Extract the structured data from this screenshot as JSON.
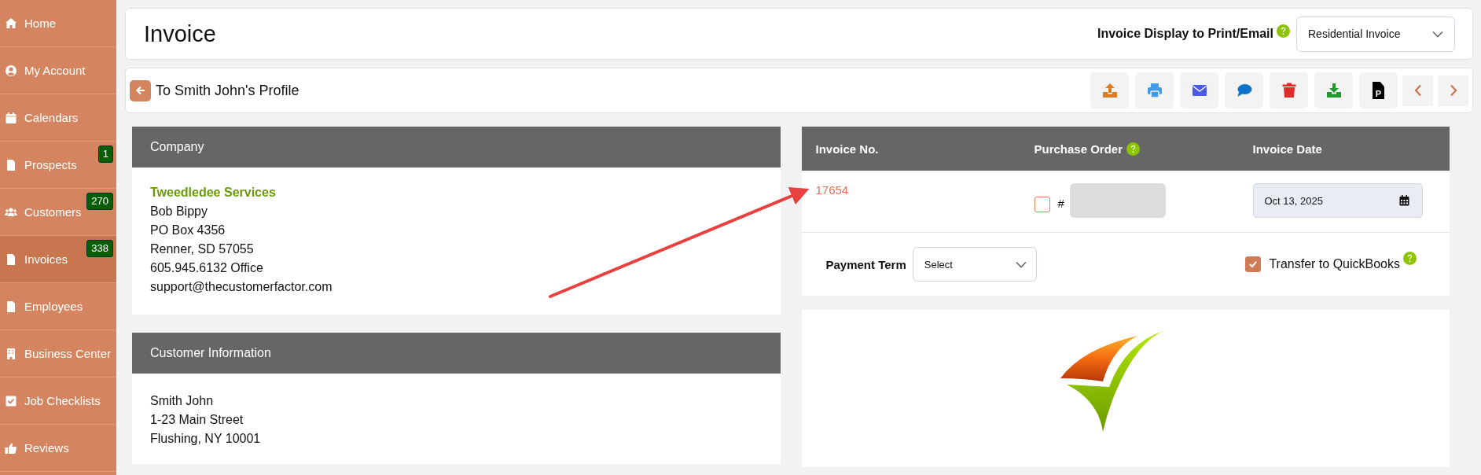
{
  "sidebar": {
    "items": [
      {
        "label": "Home",
        "selected": false
      },
      {
        "label": "My Account",
        "selected": false
      },
      {
        "label": "Calendars",
        "selected": false
      },
      {
        "label": "Prospects",
        "selected": false,
        "badge": "1"
      },
      {
        "label": "Customers",
        "selected": false,
        "badge": "270"
      },
      {
        "label": "Invoices",
        "selected": true,
        "badge": "338"
      },
      {
        "label": "Employees",
        "selected": false
      },
      {
        "label": "Business Center",
        "selected": false
      },
      {
        "label": "Job Checklists",
        "selected": false
      },
      {
        "label": "Reviews",
        "selected": false
      }
    ]
  },
  "header": {
    "title": "Invoice",
    "display_label": "Invoice Display to Print/Email",
    "display_select": "Residential Invoice"
  },
  "toolbar": {
    "back_link": "To Smith John's Profile",
    "pdf_icon_letter": "P"
  },
  "company": {
    "heading": "Company",
    "name": "Tweedledee Services",
    "lines": [
      "Bob Bippy",
      "PO Box 4356",
      "Renner, SD 57055",
      "605.945.6132 Office",
      "support@thecustomerfactor.com"
    ]
  },
  "customer": {
    "heading": "Customer Information",
    "lines": [
      "Smith John",
      "1-23 Main Street",
      "Flushing, NY 10001"
    ]
  },
  "invoice": {
    "columns": [
      "Invoice No.",
      "Purchase Order",
      "Invoice Date"
    ],
    "number": "17654",
    "po_checked": false,
    "po_hash": "#",
    "date": "Oct 13, 2025",
    "payment_term_label": "Payment Term",
    "payment_term": "Select",
    "transfer_label": "Transfer to QuickBooks",
    "transfer_checked": true
  }
}
